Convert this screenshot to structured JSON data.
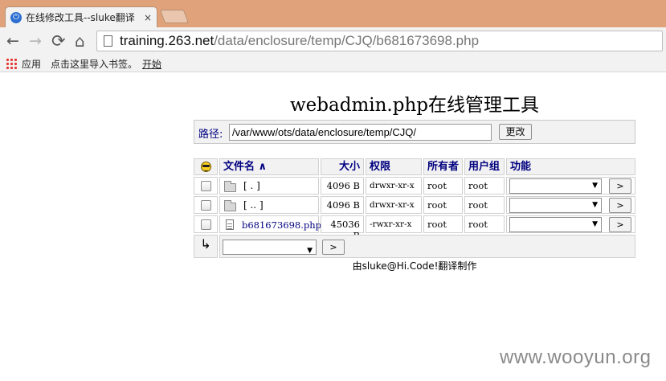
{
  "browser": {
    "tab_title": "在线修改工具--sluke翻译",
    "tab_close": "×",
    "url_host": "training.263.net",
    "url_path": "/data/enclosure/temp/CJQ/b681673698.php",
    "back": "←",
    "forward": "→",
    "reload": "⟳",
    "home": "⌂",
    "bookmarks": [
      "应用",
      "点击这里导入书签。",
      "开始"
    ]
  },
  "page": {
    "title": "webadmin.php在线管理工具",
    "path_label": "路径:",
    "path_value": "/var/www/ots/data/enclosure/temp/CJQ/",
    "change_button": "更改",
    "footer": "由sluke@Hi.Code!翻译制作"
  },
  "table": {
    "headers": {
      "name": "文件名 ∧",
      "size": "大小",
      "perm": "权限",
      "owner": "所有者",
      "group": "用户组",
      "action": "功能"
    },
    "rows": [
      {
        "type": "folder",
        "name": "[ . ]",
        "size": "4096 B",
        "perm": "drwxr-xr-x",
        "owner": "root",
        "group": "root"
      },
      {
        "type": "folder",
        "name": "[ .. ]",
        "size": "4096 B",
        "perm": "drwxr-xr-x",
        "owner": "root",
        "group": "root"
      },
      {
        "type": "file",
        "name": "b681673698.php",
        "size": "45036 B",
        "perm": "-rwxr-xr-x",
        "owner": "root",
        "group": "root"
      }
    ],
    "go_label": ">",
    "select_arrow": "▼",
    "bulk_arrow": "↳"
  },
  "watermark": "www.wooyun.org",
  "colors": {
    "titlebar": "#dfa27a",
    "header_text": "#000080",
    "link": "#000080"
  }
}
